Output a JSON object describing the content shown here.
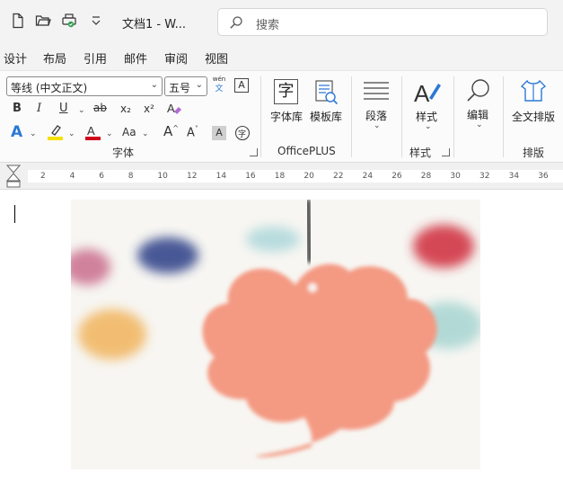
{
  "titlebar": {
    "doc_title": "文档1 - W...",
    "search_placeholder": "搜索"
  },
  "menu": {
    "tabs": [
      "设计",
      "布局",
      "引用",
      "邮件",
      "审阅",
      "视图"
    ]
  },
  "ribbon": {
    "font_name": "等线 (中文正文)",
    "font_size": "五号",
    "wen_label": "wén",
    "wen_char": "文",
    "font_group_label": "字体",
    "officeplus_group_label": "OfficePLUS",
    "style_group_label": "样式",
    "layout_group_label": "排版",
    "bold": "B",
    "italic": "I",
    "underline": "U",
    "strike": "ab",
    "subscript": "x₂",
    "superscript": "x²",
    "change_case": "Aa",
    "char_lib_label": "字体库",
    "template_lib_label": "模板库",
    "paragraph_label": "段落",
    "styles_label": "样式",
    "edit_label": "编辑",
    "full_layout_label": "全文排版",
    "char_lib_glyph": "字"
  },
  "ruler": {
    "ticks": [
      "2",
      "4",
      "6",
      "8",
      "10",
      "12",
      "14",
      "16",
      "18",
      "20",
      "22",
      "24",
      "26",
      "28",
      "30",
      "32",
      "34",
      "36"
    ]
  },
  "colors": {
    "accent_blue": "#2b78d6",
    "highlight_yellow": "#f5e100",
    "font_red": "#d0021b"
  }
}
